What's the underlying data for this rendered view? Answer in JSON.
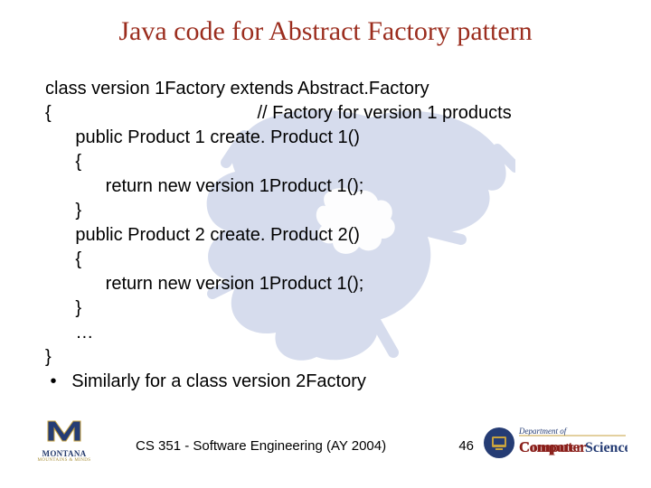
{
  "title": "Java code for Abstract Factory pattern",
  "code": {
    "l1": "class version 1Factory extends Abstract.Factory",
    "l2": "{                                         // Factory for version 1 products",
    "l3": "      public Product 1 create. Product 1()",
    "l4": "      {",
    "l5": "            return new version 1Product 1();",
    "l6": "      }",
    "l7": "      public Product 2 create. Product 2()",
    "l8": "      {",
    "l9": "            return new version 1Product 1();",
    "l10": "      }",
    "l11": "      …",
    "l12": "}",
    "l13": " •   Similarly for a class version 2Factory"
  },
  "footer": {
    "course": "CS 351 - Software Engineering (AY 2004)",
    "page": "46",
    "msu_name": "MONTANA",
    "msu_sub": "MOUNTAINS & MINDS",
    "cs_dept": "Department of",
    "cs_main": "Computer Science"
  }
}
